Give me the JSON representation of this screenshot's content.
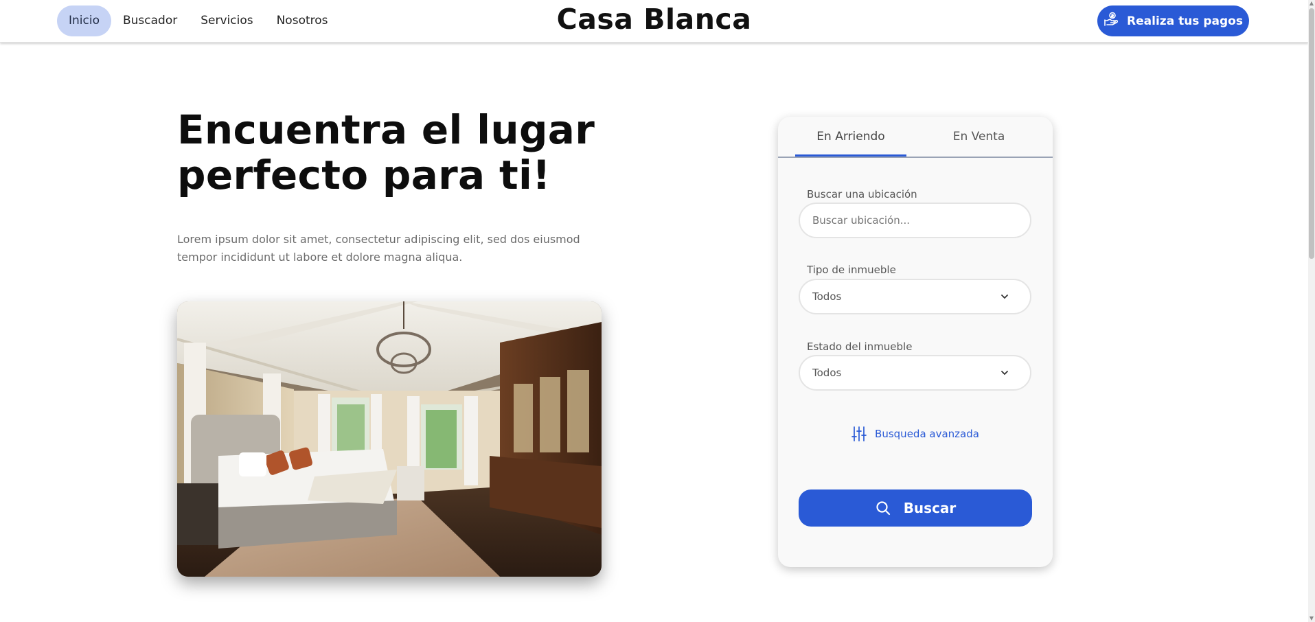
{
  "nav": {
    "items": [
      {
        "label": "Inicio",
        "active": true
      },
      {
        "label": "Buscador",
        "active": false
      },
      {
        "label": "Servicios",
        "active": false
      },
      {
        "label": "Nosotros",
        "active": false
      }
    ]
  },
  "brand": "Casa Blanca",
  "pay_button": {
    "label": "Realiza tus pagos",
    "icon": "hand-coin-icon"
  },
  "hero": {
    "title": "Encuentra el lugar perfecto para ti!",
    "text": "Lorem ipsum dolor sit amet, consectetur adipiscing elit, sed dos eiusmod tempor incididunt ut labore et dolore magna aliqua.",
    "image": "bedroom-photo"
  },
  "search_card": {
    "tabs": [
      {
        "label": "En Arriendo",
        "active": true
      },
      {
        "label": "En Venta",
        "active": false
      }
    ],
    "location": {
      "label": "Buscar una ubicación",
      "placeholder": "Buscar ubicación..."
    },
    "property_type": {
      "label": "Tipo de inmueble",
      "value": "Todos"
    },
    "property_state": {
      "label": "Estado del inmueble",
      "value": "Todos"
    },
    "advanced_link": "Busqueda avanzada",
    "search_button": "Buscar"
  },
  "colors": {
    "accent": "#2a5ad6",
    "active_nav_bg": "#c6d3f5",
    "card_bg": "#f9f9f9"
  }
}
